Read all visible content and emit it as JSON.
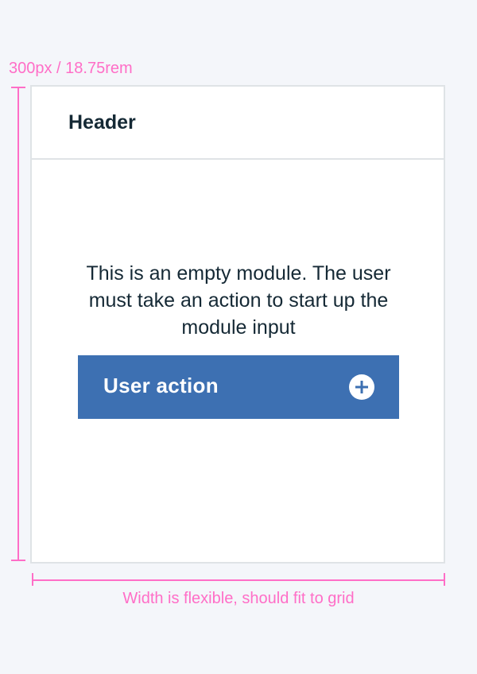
{
  "annotations": {
    "height_label": "300px / 18.75rem",
    "width_label": "Width is flexible, should fit to grid",
    "color": "#ff6ec7"
  },
  "module": {
    "header": "Header",
    "empty_message": "This is an empty module. The user must take an action to start up the module input",
    "action": {
      "label": "User action",
      "icon": "add-circle-icon",
      "color": "#3d70b2"
    }
  }
}
